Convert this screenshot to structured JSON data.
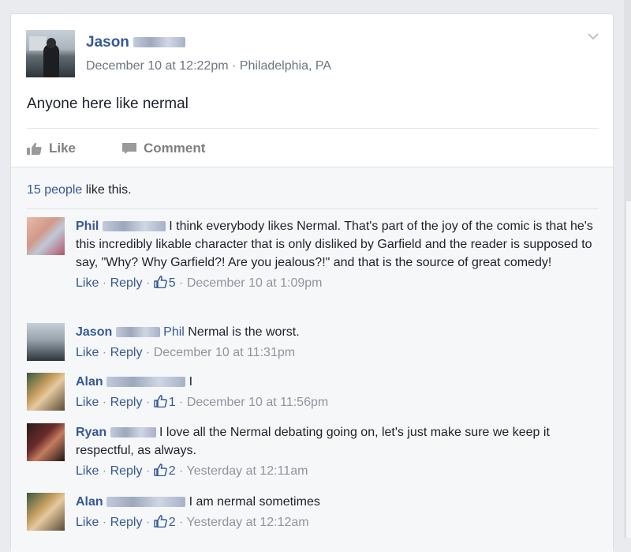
{
  "post": {
    "author_first": "Jason",
    "timestamp": "December 10 at 12:22pm",
    "separator": "·",
    "location": "Philadelphia, PA",
    "text": "Anyone here like nermal"
  },
  "actions": {
    "like_label": "Like",
    "comment_label": "Comment"
  },
  "likes_summary": {
    "count_link": "15 people",
    "rest": " like this."
  },
  "comment_actions": {
    "like": "Like",
    "reply": "Reply",
    "dot": " · "
  },
  "comments": [
    {
      "name": "Phil",
      "text": " I think everybody likes Nermal. That's part of the joy of the comic is that he's this incredibly likable character that is only disliked by Garfield and the reader is supposed to say, \"Why? Why Garfield?! Are you jealous?!\" and that is the source of great comedy!",
      "likes": "5",
      "time": "December 10 at 1:09pm"
    },
    {
      "name": "Jason",
      "mention": "Phil",
      "text": " Nermal is the worst.",
      "time": "December 10 at 11:31pm"
    },
    {
      "name": "Alan",
      "text": " I",
      "likes": "1",
      "time": "December 10 at 11:56pm"
    },
    {
      "name": "Ryan",
      "text": " I love all the Nermal debating going on, let's just make sure we keep it respectful, as always.",
      "likes": "2",
      "time": "Yesterday at 12:11am"
    },
    {
      "name": "Alan",
      "text": " I am nermal sometimes",
      "likes": "2",
      "time": "Yesterday at 12:12am"
    }
  ],
  "colors": {
    "link": "#365899",
    "meta": "#90949c",
    "background": "#e9ebee"
  }
}
